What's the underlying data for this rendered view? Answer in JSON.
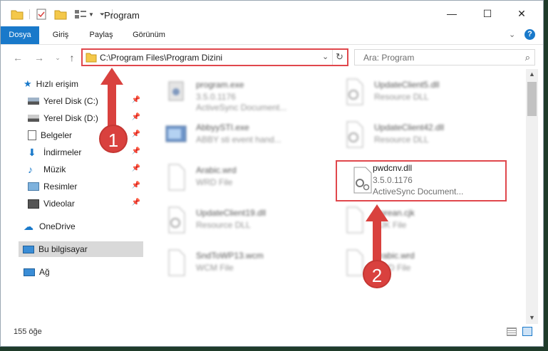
{
  "titlebar": {
    "title": "Program",
    "minimize": "—",
    "maximize": "☐",
    "close": "✕"
  },
  "ribbon": {
    "tabs": [
      "Dosya",
      "Giriş",
      "Paylaş",
      "Görünüm"
    ]
  },
  "address": {
    "path": "C:\\Program Files\\Program Dizini",
    "search_placeholder": "Ara: Program"
  },
  "nav": {
    "items": [
      {
        "label": "Hızlı erişim",
        "icon": "star-icon"
      },
      {
        "label": "Yerel Disk (C:)",
        "icon": "drive-icon"
      },
      {
        "label": "Yerel Disk (D:)",
        "icon": "drive-icon"
      },
      {
        "label": "Belgeler",
        "icon": "documents-icon"
      },
      {
        "label": "İndirmeler",
        "icon": "download-icon"
      },
      {
        "label": "Müzik",
        "icon": "music-icon"
      },
      {
        "label": "Resimler",
        "icon": "pictures-icon"
      },
      {
        "label": "Videolar",
        "icon": "videos-icon"
      },
      {
        "label": "OneDrive",
        "icon": "cloud-icon"
      },
      {
        "label": "Bu bilgisayar",
        "icon": "computer-icon"
      },
      {
        "label": "Ağ",
        "icon": "network-icon"
      }
    ]
  },
  "files": [
    {
      "name": "program.exe",
      "line1": "3.5.0.1176",
      "line2": "ActiveSync Document..."
    },
    {
      "name": "UpdateClient5.dll",
      "line1": "Resource DLL",
      "line2": ""
    },
    {
      "name": "AbbyySTI.exe",
      "line1": "ABBY sti event hand...",
      "line2": ""
    },
    {
      "name": "UpdateClient42.dll",
      "line1": "Resource DLL",
      "line2": ""
    },
    {
      "name": "Arabic.wrd",
      "line1": "WRD File",
      "line2": ""
    },
    {
      "name": "pwdcnv.dll",
      "line1": "3.5.0.1176",
      "line2": "ActiveSync Document..."
    },
    {
      "name": "UpdateClient19.dll",
      "line1": "Resource DLL",
      "line2": ""
    },
    {
      "name": "Korean.cjk",
      "line1": "CJK File",
      "line2": ""
    },
    {
      "name": "SndToWP13.wcm",
      "line1": "WCM File",
      "line2": ""
    },
    {
      "name": "Arabic.wrd",
      "line1": "WRD File",
      "line2": ""
    }
  ],
  "status": {
    "count": "155 öğe"
  },
  "markers": {
    "one": "1",
    "two": "2"
  },
  "colors": {
    "accent": "#1979ca",
    "highlight": "#e0474c"
  }
}
